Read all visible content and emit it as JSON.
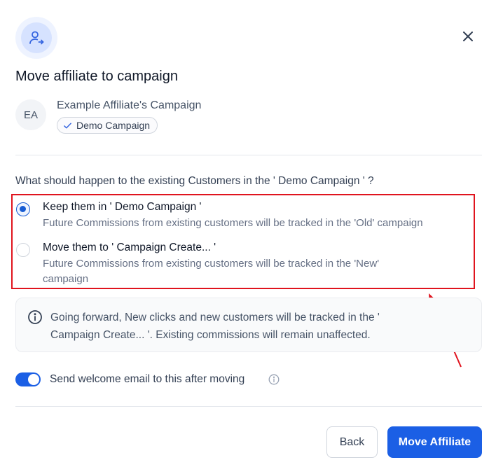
{
  "dialog": {
    "title": "Move affiliate to campaign",
    "close_label": "×"
  },
  "affiliate": {
    "initials": "EA",
    "name": "Example Affiliate's Campaign",
    "current_campaign": "Demo Campaign"
  },
  "question": "What should happen to the existing Customers in the ' Demo Campaign ' ?",
  "options": [
    {
      "title": "Keep them in ' Demo Campaign '",
      "description": "Future Commissions from existing customers will be tracked in the 'Old' campaign",
      "selected": true
    },
    {
      "title": "Move them to ' Campaign Create... '",
      "description_line1": "Future Commissions from existing customers will be tracked in the 'New'",
      "description_line2": "campaign",
      "selected": false
    }
  ],
  "info": {
    "line1": "Going forward, New clicks and new customers will be tracked in the '",
    "line2": "Campaign Create... '. Existing commissions will remain unaffected."
  },
  "welcome_email": {
    "label": "Send welcome email to this after moving",
    "enabled": true
  },
  "footer": {
    "back_label": "Back",
    "move_label": "Move Affiliate"
  },
  "colors": {
    "primary": "#1b5fe5",
    "annotation_red": "#e0141e"
  },
  "icons": {
    "header": "user-arrow-icon",
    "close": "close-icon",
    "chip": "check-icon",
    "info": "info-circle-icon",
    "tooltip": "info-tooltip-icon"
  }
}
